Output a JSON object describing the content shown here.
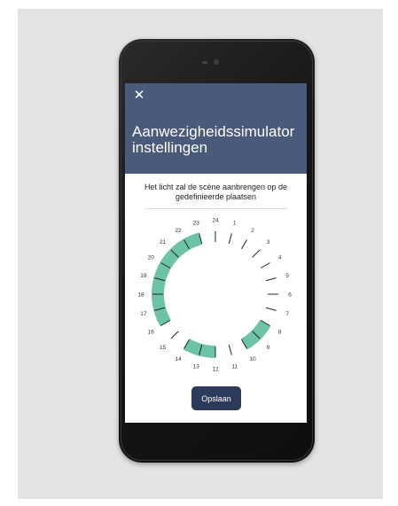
{
  "header": {
    "close_label": "✕",
    "title_line1": "Aanwezigheidssimulator",
    "title_line2": "instellingen"
  },
  "content": {
    "subtitle": "Het licht zal de scène aanbrengen op de gedefinieerde plaatsen"
  },
  "dial": {
    "hours": [
      "24",
      "1",
      "2",
      "3",
      "4",
      "5",
      "6",
      "7",
      "8",
      "9",
      "10",
      "11",
      "12",
      "13",
      "14",
      "15",
      "16",
      "17",
      "18",
      "19",
      "20",
      "21",
      "22",
      "23"
    ],
    "active_ranges": [
      {
        "from": 8,
        "to": 10
      },
      {
        "from": 12,
        "to": 14
      },
      {
        "from": 16,
        "to": 23
      }
    ],
    "active_color": "#6cc3a8",
    "tick_color": "#222222",
    "label_color": "#333333"
  },
  "actions": {
    "save_label": "Opslaan"
  },
  "colors": {
    "header_bg": "#4a5a7a",
    "button_bg": "#2c3a5c",
    "backdrop": "#e4e4e4"
  }
}
